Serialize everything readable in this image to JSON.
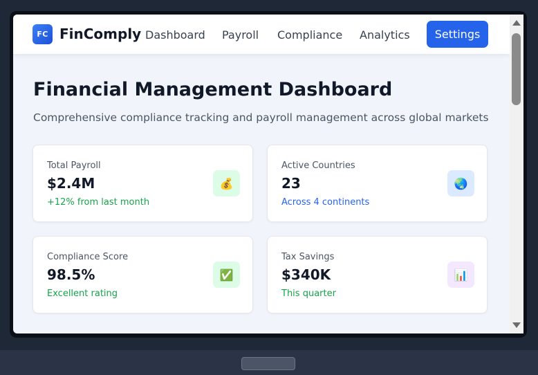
{
  "nav": {
    "logo_text": "FC",
    "brand": "FinComply",
    "links": [
      "Dashboard",
      "Payroll",
      "Compliance",
      "Analytics"
    ],
    "settings_label": "Settings"
  },
  "page": {
    "title": "Financial Management Dashboard",
    "subtitle": "Comprehensive compliance tracking and payroll management across global markets"
  },
  "cards": [
    {
      "label": "Total Payroll",
      "value": "$2.4M",
      "note": "+12% from last month",
      "note_color": "#16a34a",
      "icon": "money-bag-icon",
      "icon_glyph": "💰",
      "icon_bg": "#dcfce7"
    },
    {
      "label": "Active Countries",
      "value": "23",
      "note": "Across 4 continents",
      "note_color": "#2563eb",
      "icon": "globe-icon",
      "icon_glyph": "🌏",
      "icon_bg": "#dbeafe"
    },
    {
      "label": "Compliance Score",
      "value": "98.5%",
      "note": "Excellent rating",
      "note_color": "#16a34a",
      "icon": "check-box-icon",
      "icon_glyph": "✅",
      "icon_bg": "#dcfce7"
    },
    {
      "label": "Tax Savings",
      "value": "$340K",
      "note": "This quarter",
      "note_color": "#16a34a",
      "icon": "bar-chart-icon",
      "icon_glyph": "📊",
      "icon_bg": "#f3e8ff"
    }
  ]
}
